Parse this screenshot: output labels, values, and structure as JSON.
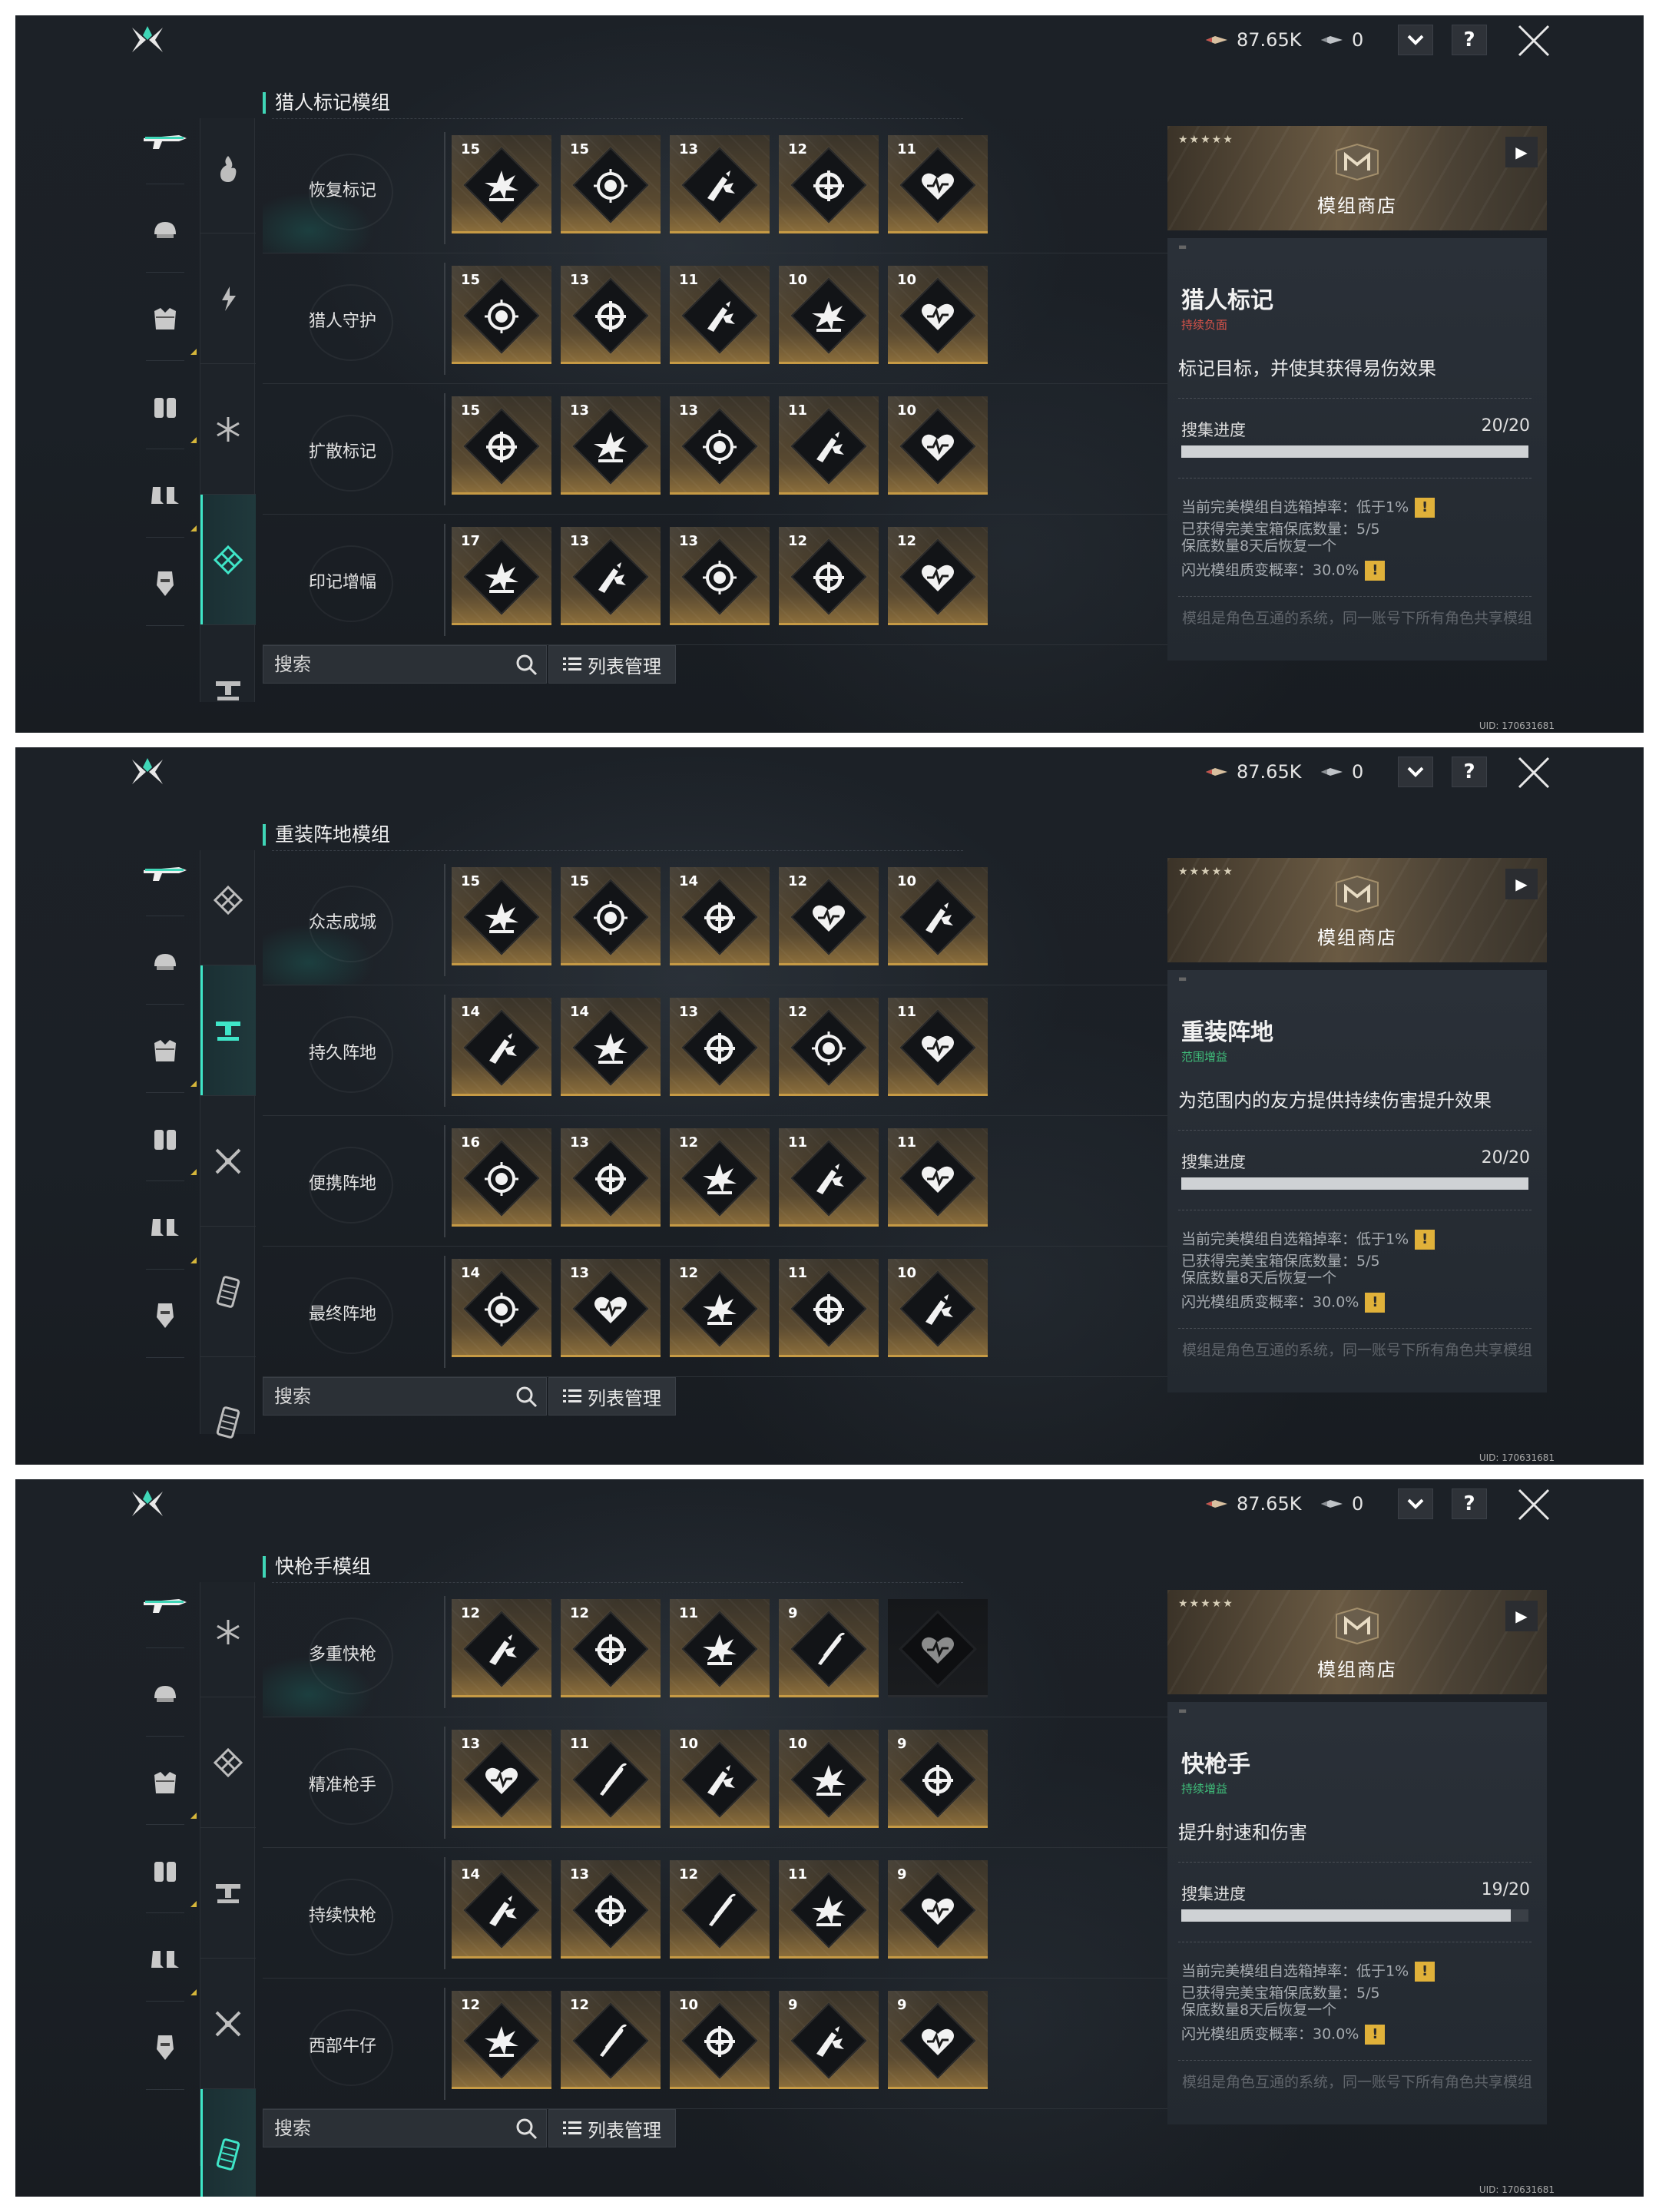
{
  "header": {
    "currency1": "87.65K",
    "currency2": "0",
    "dropdown_icon": "chevron-down-icon",
    "help_label": "?",
    "close_icon": "close-x-icon"
  },
  "shop": {
    "stars": "★★★★★",
    "label": "模组商店",
    "arrow": "▶"
  },
  "search": {
    "placeholder": "搜索"
  },
  "list_button": {
    "label": "列表管理"
  },
  "colors": {
    "accent": "#3fd6b7",
    "gold": "#c69a45",
    "warn": "#e0b13a"
  },
  "screens": [
    {
      "section_title": "猎人标记模组",
      "rows": [
        {
          "label": "恢复标记",
          "cards": [
            {
              "level": "15",
              "icon": "burst-icon"
            },
            {
              "level": "15",
              "icon": "target-ring-icon"
            },
            {
              "level": "13",
              "icon": "bullet-burst-icon"
            },
            {
              "level": "12",
              "icon": "crosshair-icon"
            },
            {
              "level": "11",
              "icon": "heart-pulse-icon"
            }
          ]
        },
        {
          "label": "猎人守护",
          "cards": [
            {
              "level": "15",
              "icon": "target-ring-icon"
            },
            {
              "level": "13",
              "icon": "crosshair-icon"
            },
            {
              "level": "11",
              "icon": "bullet-burst-icon"
            },
            {
              "level": "10",
              "icon": "burst-icon"
            },
            {
              "level": "10",
              "icon": "heart-pulse-icon"
            }
          ]
        },
        {
          "label": "扩散标记",
          "cards": [
            {
              "level": "15",
              "icon": "crosshair-icon"
            },
            {
              "level": "13",
              "icon": "burst-icon"
            },
            {
              "level": "13",
              "icon": "target-ring-icon"
            },
            {
              "level": "11",
              "icon": "bullet-burst-icon"
            },
            {
              "level": "10",
              "icon": "heart-pulse-icon"
            }
          ]
        },
        {
          "label": "印记增幅",
          "cards": [
            {
              "level": "17",
              "icon": "burst-icon"
            },
            {
              "level": "13",
              "icon": "bullet-burst-icon"
            },
            {
              "level": "13",
              "icon": "target-ring-icon"
            },
            {
              "level": "12",
              "icon": "crosshair-icon"
            },
            {
              "level": "12",
              "icon": "heart-pulse-icon"
            }
          ]
        }
      ],
      "detail": {
        "name": "猎人标记",
        "tag": "持续负面",
        "tag_color": "#d8534a",
        "desc": "标记目标，并使其获得易伤效果",
        "progress_label": "搜集进度",
        "progress_value": "20/20",
        "progress_fraction": 1.0,
        "info1": "当前完美模组自选箱掉率：低于1%",
        "info2a": "已获得完美宝箱保底数量：5/5",
        "info2b": "保底数量8天后恢复一个",
        "info3": "闪光模组质变概率：30.0%",
        "footer": "模组是角色互通的系统，同一账号下所有角色共享模组"
      },
      "uid": "UID: 170631681"
    },
    {
      "section_title": "重装阵地模组",
      "rows": [
        {
          "label": "众志成城",
          "cards": [
            {
              "level": "15",
              "icon": "burst-icon"
            },
            {
              "level": "15",
              "icon": "target-ring-icon"
            },
            {
              "level": "14",
              "icon": "crosshair-icon"
            },
            {
              "level": "12",
              "icon": "heart-pulse-icon"
            },
            {
              "level": "10",
              "icon": "bullet-burst-icon"
            }
          ]
        },
        {
          "label": "持久阵地",
          "cards": [
            {
              "level": "14",
              "icon": "bullet-burst-icon"
            },
            {
              "level": "14",
              "icon": "burst-icon"
            },
            {
              "level": "13",
              "icon": "crosshair-icon"
            },
            {
              "level": "12",
              "icon": "target-ring-icon"
            },
            {
              "level": "11",
              "icon": "heart-pulse-icon"
            }
          ]
        },
        {
          "label": "便携阵地",
          "cards": [
            {
              "level": "16",
              "icon": "target-ring-icon"
            },
            {
              "level": "13",
              "icon": "crosshair-icon"
            },
            {
              "level": "12",
              "icon": "burst-icon"
            },
            {
              "level": "11",
              "icon": "bullet-burst-icon"
            },
            {
              "level": "11",
              "icon": "heart-pulse-icon"
            }
          ]
        },
        {
          "label": "最终阵地",
          "cards": [
            {
              "level": "14",
              "icon": "target-ring-icon"
            },
            {
              "level": "13",
              "icon": "heart-pulse-icon"
            },
            {
              "level": "12",
              "icon": "burst-icon"
            },
            {
              "level": "11",
              "icon": "crosshair-icon"
            },
            {
              "level": "10",
              "icon": "bullet-burst-icon"
            }
          ]
        }
      ],
      "detail": {
        "name": "重装阵地",
        "tag": "范围增益",
        "tag_color": "#3fbf7a",
        "desc": "为范围内的友方提供持续伤害提升效果",
        "progress_label": "搜集进度",
        "progress_value": "20/20",
        "progress_fraction": 1.0,
        "info1": "当前完美模组自选箱掉率：低于1%",
        "info2a": "已获得完美宝箱保底数量：5/5",
        "info2b": "保底数量8天后恢复一个",
        "info3": "闪光模组质变概率：30.0%",
        "footer": "模组是角色互通的系统，同一账号下所有角色共享模组"
      },
      "uid": "UID: 170631681"
    },
    {
      "section_title": "快枪手模组",
      "rows": [
        {
          "label": "多重快枪",
          "cards": [
            {
              "level": "12",
              "icon": "bullet-burst-icon"
            },
            {
              "level": "12",
              "icon": "crosshair-icon"
            },
            {
              "level": "11",
              "icon": "burst-icon"
            },
            {
              "level": "9",
              "icon": "bullets-icon"
            },
            {
              "level": "",
              "icon": "heart-pulse-icon",
              "locked": true
            }
          ]
        },
        {
          "label": "精准枪手",
          "cards": [
            {
              "level": "13",
              "icon": "heart-pulse-icon"
            },
            {
              "level": "11",
              "icon": "bullets-icon"
            },
            {
              "level": "10",
              "icon": "bullet-burst-icon"
            },
            {
              "level": "10",
              "icon": "burst-icon"
            },
            {
              "level": "9",
              "icon": "crosshair-icon"
            }
          ]
        },
        {
          "label": "持续快枪",
          "cards": [
            {
              "level": "14",
              "icon": "bullet-burst-icon"
            },
            {
              "level": "13",
              "icon": "crosshair-icon"
            },
            {
              "level": "12",
              "icon": "bullets-icon"
            },
            {
              "level": "11",
              "icon": "burst-icon"
            },
            {
              "level": "9",
              "icon": "heart-pulse-icon"
            }
          ]
        },
        {
          "label": "西部牛仔",
          "cards": [
            {
              "level": "12",
              "icon": "burst-icon"
            },
            {
              "level": "12",
              "icon": "bullets-icon"
            },
            {
              "level": "10",
              "icon": "crosshair-icon"
            },
            {
              "level": "9",
              "icon": "bullet-burst-icon"
            },
            {
              "level": "9",
              "icon": "heart-pulse-icon"
            }
          ]
        }
      ],
      "detail": {
        "name": "快枪手",
        "tag": "持续增益",
        "tag_color": "#3fbf7a",
        "desc": "提升射速和伤害",
        "progress_label": "搜集进度",
        "progress_value": "19/20",
        "progress_fraction": 0.95,
        "info1": "当前完美模组自选箱掉率：低于1%",
        "info2a": "已获得完美宝箱保底数量：5/5",
        "info2b": "保底数量8天后恢复一个",
        "info3": "闪光模组质变概率：30.0%",
        "footer": "模组是角色互通的系统，同一账号下所有角色共享模组"
      },
      "uid": "UID: 170631681"
    }
  ]
}
